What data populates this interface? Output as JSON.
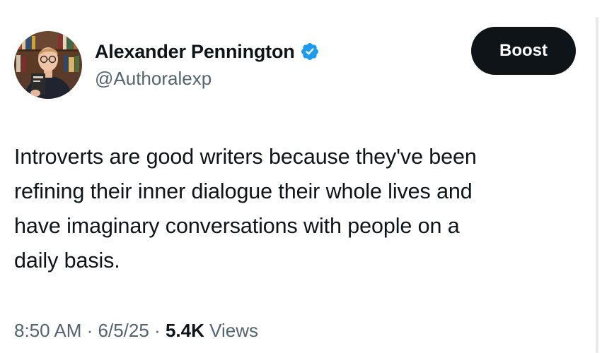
{
  "author": {
    "display_name": "Alexander Pennington",
    "handle": "@Authoralexp",
    "verified_icon": "verified-badge-icon",
    "verified_color": "#1d9bf0"
  },
  "actions": {
    "boost_label": "Boost"
  },
  "tweet": {
    "text_lines": [
      "Introverts are good writers because they've been",
      "refining their inner dialogue their whole lives and",
      "have imaginary conversations with people on a",
      "daily basis."
    ]
  },
  "meta": {
    "time": "8:50 AM",
    "separator": "·",
    "date": "6/5/25",
    "views_count": "5.4K",
    "views_label": "Views"
  },
  "colors": {
    "text_primary": "#0f1419",
    "text_secondary": "#536471",
    "button_bg": "#0f1419",
    "button_text": "#ffffff"
  }
}
